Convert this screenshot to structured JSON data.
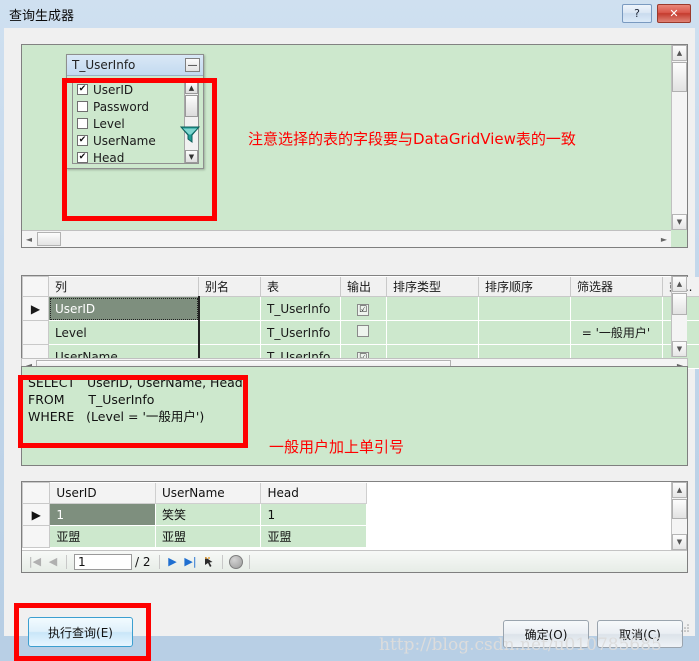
{
  "window": {
    "title": "查询生成器",
    "help_button": "?",
    "close_button": "✕"
  },
  "diagram": {
    "table": {
      "name": "T_UserInfo",
      "minimize_label": "—",
      "fields": [
        {
          "name": "UserID",
          "checked": true,
          "mark": "✔"
        },
        {
          "name": "Password",
          "checked": false,
          "mark": ""
        },
        {
          "name": "Level",
          "checked": false,
          "mark": ""
        },
        {
          "name": "UserName",
          "checked": true,
          "mark": "✔"
        },
        {
          "name": "Head",
          "checked": true,
          "mark": "✔"
        }
      ],
      "scroll_up": "▲",
      "scroll_down": "▼"
    },
    "filter_icon": "funnel-icon",
    "annotation": "注意选择的表的字段要与DataGridView表的一致",
    "scroll_up": "▲",
    "scroll_down": "▼",
    "scroll_left": "◄",
    "scroll_right": "►"
  },
  "criteria_grid": {
    "columns": [
      "列",
      "别名",
      "表",
      "输出",
      "排序类型",
      "排序顺序",
      "筛选器",
      "或..."
    ],
    "rows": [
      {
        "selector": "▶",
        "column": "UserID",
        "alias": "",
        "table": "T_UserInfo",
        "output": "☑",
        "sort_type": "",
        "sort_order": "",
        "filter": "",
        "or": "",
        "selected": true
      },
      {
        "selector": "",
        "column": "Level",
        "alias": "",
        "table": "T_UserInfo",
        "output": "☐",
        "sort_type": "",
        "sort_order": "",
        "filter": "= '一般用户'",
        "or": "",
        "selected": false
      },
      {
        "selector": "",
        "column": "UserName",
        "alias": "",
        "table": "T_UserInfo",
        "output": "☑",
        "sort_type": "",
        "sort_order": "",
        "filter": "",
        "or": "",
        "selected": false
      }
    ],
    "scroll_up": "▲",
    "scroll_down": "▼"
  },
  "sql": {
    "text": "SELECT   UserID, UserName, Head\nFROM      T_UserInfo\nWHERE   (Level = '一般用户')",
    "annotation": "一般用户加上单引号",
    "scroll_left": "◄",
    "scroll_right": "►"
  },
  "results": {
    "columns": [
      "UserID",
      "UserName",
      "Head"
    ],
    "rows": [
      {
        "selector": "▶",
        "UserID": "1",
        "UserName": "笑笑",
        "Head": "1",
        "selected": true
      },
      {
        "selector": "",
        "UserID": "亚盟",
        "UserName": "亚盟",
        "Head": "亚盟",
        "selected": false
      }
    ],
    "navigator": {
      "first": "|◀",
      "prev": "◀",
      "page_value": "1",
      "page_total": "/ 2",
      "next": "▶",
      "last": "▶|",
      "add_icon": "new-record-icon",
      "stop_icon": "stop-icon"
    },
    "scroll_up": "▲",
    "scroll_down": "▼"
  },
  "footer": {
    "execute_label": "执行查询(E)",
    "execute_mnemonic": "E",
    "ok_label": "确定(O)",
    "ok_mnemonic": "O",
    "cancel_label": "取消(C)",
    "cancel_mnemonic": "C",
    "watermark": "http://blog.csdn.net/u010785685"
  },
  "colors": {
    "pane_background": "#cde8cd",
    "annotation_red": "#ff0000",
    "highlight_box": "#fe0000",
    "selected_cell": "#7e8f7e",
    "accent_blue": "#1f6fd0"
  }
}
